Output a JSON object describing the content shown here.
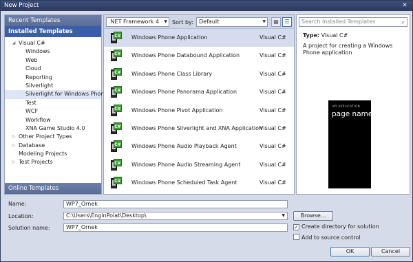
{
  "window": {
    "title": "New Project",
    "close_glyph": "✕"
  },
  "left": {
    "recent_header": "Recent Templates",
    "installed_header": "Installed Templates",
    "tree": [
      {
        "label": "Visual C#",
        "indent": 0,
        "arrow": "◢"
      },
      {
        "label": "Windows",
        "indent": 1,
        "arrow": ""
      },
      {
        "label": "Web",
        "indent": 1,
        "arrow": ""
      },
      {
        "label": "Cloud",
        "indent": 1,
        "arrow": ""
      },
      {
        "label": "Reporting",
        "indent": 1,
        "arrow": ""
      },
      {
        "label": "Silverlight",
        "indent": 1,
        "arrow": ""
      },
      {
        "label": "Silverlight for Windows Phone",
        "indent": 1,
        "arrow": "",
        "selected": true
      },
      {
        "label": "Test",
        "indent": 1,
        "arrow": ""
      },
      {
        "label": "WCF",
        "indent": 1,
        "arrow": ""
      },
      {
        "label": "Workflow",
        "indent": 1,
        "arrow": ""
      },
      {
        "label": "XNA Game Studio 4.0",
        "indent": 1,
        "arrow": ""
      },
      {
        "label": "Other Project Types",
        "indent": 0,
        "arrow": "▷"
      },
      {
        "label": "Database",
        "indent": 0,
        "arrow": "▷"
      },
      {
        "label": "Modeling Projects",
        "indent": 0,
        "arrow": ""
      },
      {
        "label": "Test Projects",
        "indent": 0,
        "arrow": "▷"
      }
    ],
    "online_header": "Online Templates"
  },
  "toolbar": {
    "framework": ".NET Framework 4",
    "sort_label": "Sort by:",
    "sort_value": "Default"
  },
  "templates": [
    {
      "name": "Windows Phone Application",
      "lang": "Visual C#",
      "selected": true
    },
    {
      "name": "Windows Phone Databound Application",
      "lang": "Visual C#"
    },
    {
      "name": "Windows Phone Class Library",
      "lang": "Visual C#"
    },
    {
      "name": "Windows Phone Panorama Application",
      "lang": "Visual C#"
    },
    {
      "name": "Windows Phone Pivot Application",
      "lang": "Visual C#"
    },
    {
      "name": "Windows Phone Silverlight and XNA Application",
      "lang": "Visual C#"
    },
    {
      "name": "Windows Phone Audio Playback Agent",
      "lang": "Visual C#"
    },
    {
      "name": "Windows Phone Audio Streaming Agent",
      "lang": "Visual C#"
    },
    {
      "name": "Windows Phone Scheduled Task Agent",
      "lang": "Visual C#"
    }
  ],
  "right": {
    "search_placeholder": "Search Installed Templates",
    "type_label": "Type:",
    "type_value": "Visual C#",
    "description": "A project for creating a Windows Phone application",
    "preview_small": "MY APPLICATION",
    "preview_big": "page name"
  },
  "form": {
    "name_label": "Name:",
    "name_value": "WP7_Ornek",
    "location_label": "Location:",
    "location_value": "C:\\Users\\EnginPolat\\Desktop\\",
    "solution_label": "Solution name:",
    "solution_value": "WP7_Ornek",
    "browse": "Browse...",
    "create_dir": "Create directory for solution",
    "create_dir_checked": true,
    "add_sc": "Add to source control",
    "add_sc_checked": false,
    "ok": "OK",
    "cancel": "Cancel"
  }
}
